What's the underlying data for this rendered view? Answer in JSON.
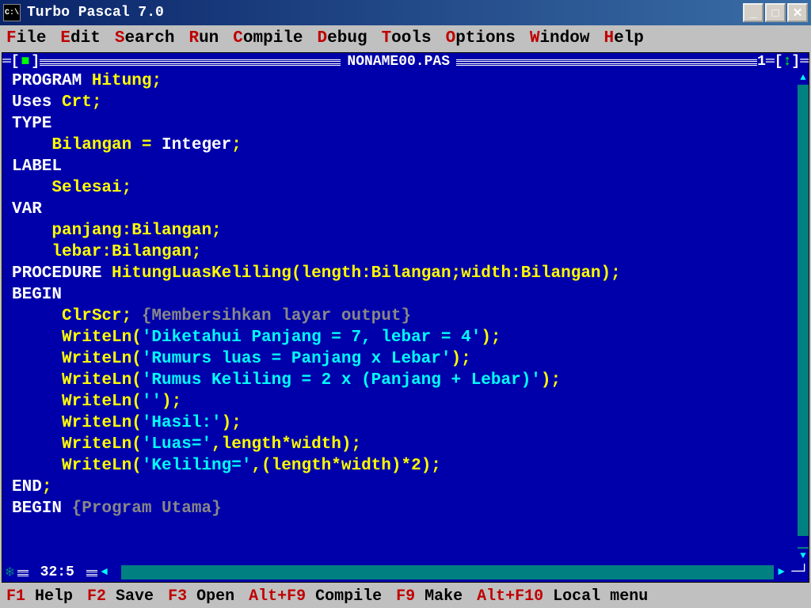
{
  "window": {
    "title": "Turbo Pascal 7.0",
    "icon": "C:\\"
  },
  "menubar": [
    {
      "hotkey": "F",
      "rest": "ile"
    },
    {
      "hotkey": "E",
      "rest": "dit"
    },
    {
      "hotkey": "S",
      "rest": "earch"
    },
    {
      "hotkey": "R",
      "rest": "un"
    },
    {
      "hotkey": "C",
      "rest": "ompile"
    },
    {
      "hotkey": "D",
      "rest": "ebug"
    },
    {
      "hotkey": "T",
      "rest": "ools"
    },
    {
      "hotkey": "O",
      "rest": "ptions"
    },
    {
      "hotkey": "W",
      "rest": "indow"
    },
    {
      "hotkey": "H",
      "rest": "elp"
    }
  ],
  "editor": {
    "filename": "NONAME00.PAS",
    "window_number": "1",
    "cursor_pos": "32:5",
    "close_glyph": "■",
    "maximize_glyph": "↕"
  },
  "code": [
    [
      {
        "c": "kw",
        "t": "PROGRAM "
      },
      {
        "c": "",
        "t": "Hitung;"
      }
    ],
    [
      {
        "c": "kw",
        "t": "Uses "
      },
      {
        "c": "",
        "t": "Crt;"
      }
    ],
    [
      {
        "c": "kw",
        "t": "TYPE"
      }
    ],
    [
      {
        "c": "",
        "t": "    Bilangan = "
      },
      {
        "c": "kw",
        "t": "Integer"
      },
      {
        "c": "",
        "t": ";"
      }
    ],
    [
      {
        "c": "kw",
        "t": "LABEL"
      }
    ],
    [
      {
        "c": "",
        "t": "    Selesai;"
      }
    ],
    [
      {
        "c": "kw",
        "t": "VAR"
      }
    ],
    [
      {
        "c": "",
        "t": "    panjang:Bilangan;"
      }
    ],
    [
      {
        "c": "",
        "t": "    lebar:Bilangan;"
      }
    ],
    [
      {
        "c": "kw",
        "t": "PROCEDURE "
      },
      {
        "c": "",
        "t": "HitungLuasKeliling(length:Bilangan;width:Bilangan);"
      }
    ],
    [
      {
        "c": "kw",
        "t": "BEGIN"
      }
    ],
    [
      {
        "c": "",
        "t": "     ClrScr; "
      },
      {
        "c": "cm",
        "t": "{Membersihkan layar output}"
      }
    ],
    [
      {
        "c": "",
        "t": "     WriteLn("
      },
      {
        "c": "txt",
        "t": "'Diketahui Panjang = 7, lebar = 4'"
      },
      {
        "c": "",
        "t": ");"
      }
    ],
    [
      {
        "c": "",
        "t": "     WriteLn("
      },
      {
        "c": "txt",
        "t": "'Rumurs luas = Panjang x Lebar'"
      },
      {
        "c": "",
        "t": ");"
      }
    ],
    [
      {
        "c": "",
        "t": "     WriteLn("
      },
      {
        "c": "txt",
        "t": "'Rumus Keliling = 2 x (Panjang + Lebar)'"
      },
      {
        "c": "",
        "t": ");"
      }
    ],
    [
      {
        "c": "",
        "t": "     WriteLn("
      },
      {
        "c": "txt",
        "t": "''"
      },
      {
        "c": "",
        "t": ");"
      }
    ],
    [
      {
        "c": "",
        "t": "     WriteLn("
      },
      {
        "c": "txt",
        "t": "'Hasil:'"
      },
      {
        "c": "",
        "t": ");"
      }
    ],
    [
      {
        "c": "",
        "t": "     WriteLn("
      },
      {
        "c": "txt",
        "t": "'Luas='"
      },
      {
        "c": "",
        "t": ",length*width);"
      }
    ],
    [
      {
        "c": "",
        "t": "     WriteLn("
      },
      {
        "c": "txt",
        "t": "'Keliling='"
      },
      {
        "c": "",
        "t": ",(length*width)*2);"
      }
    ],
    [
      {
        "c": "kw",
        "t": "END"
      },
      {
        "c": "",
        "t": ";"
      }
    ],
    [
      {
        "c": "kw",
        "t": "BEGIN "
      },
      {
        "c": "cm",
        "t": "{Program Utama}"
      }
    ]
  ],
  "statusbar": [
    {
      "key": "F1",
      "label": " Help"
    },
    {
      "key": "F2",
      "label": " Save"
    },
    {
      "key": "F3",
      "label": " Open"
    },
    {
      "key": "Alt+F9",
      "label": " Compile"
    },
    {
      "key": "F9",
      "label": " Make"
    },
    {
      "key": "Alt+F10",
      "label": " Local menu"
    }
  ]
}
